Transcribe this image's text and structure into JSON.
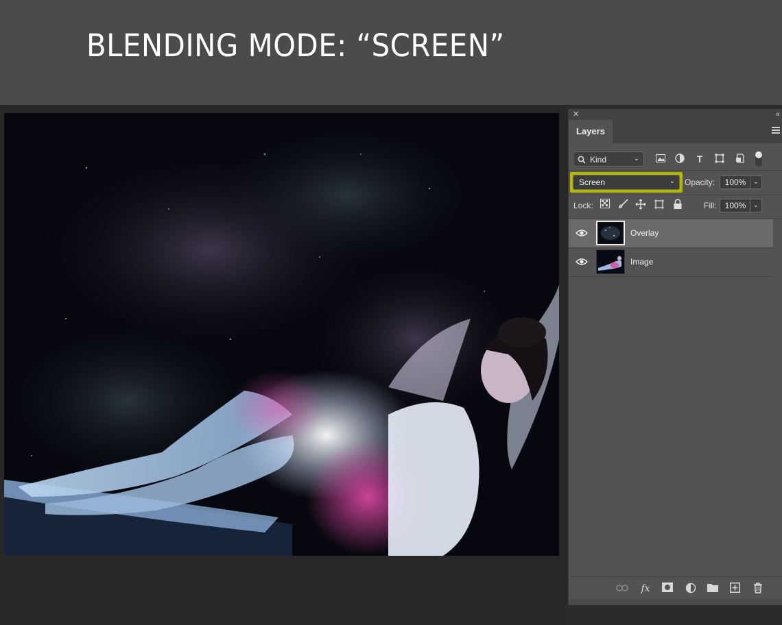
{
  "banner": {
    "title": "BLENDING MODE: “SCREEN”"
  },
  "panel": {
    "tab_label": "Layers",
    "filter": {
      "kind_label": "Kind",
      "icons": [
        "image-filter-icon",
        "adjustment-filter-icon",
        "type-filter-icon",
        "shape-filter-icon",
        "smart-object-filter-icon"
      ]
    },
    "blend_mode": "Screen",
    "opacity_label": "Opacity:",
    "opacity_value": "100%",
    "lock_label": "Lock:",
    "fill_label": "Fill:",
    "fill_value": "100%",
    "layers": [
      {
        "name": "Overlay",
        "visible": true,
        "selected": true
      },
      {
        "name": "Image",
        "visible": true,
        "selected": false
      }
    ],
    "bottom_icons": [
      "link-layers-icon",
      "fx-icon",
      "add-mask-icon",
      "adjustment-layer-icon",
      "new-group-icon",
      "new-layer-icon",
      "delete-layer-icon"
    ],
    "fx_label": "fx"
  },
  "colors": {
    "banner_bg": "#4b4b4b",
    "panel_bg": "#535353",
    "highlight": "#b7b800",
    "selected_row": "#6a6a6a"
  }
}
